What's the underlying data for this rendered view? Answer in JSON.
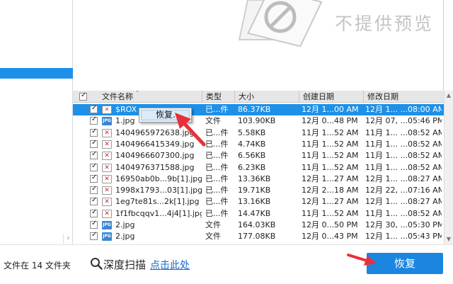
{
  "preview": {
    "no_preview_text": "不提供预览"
  },
  "table": {
    "columns": {
      "name": "文件名称",
      "type": "类型",
      "size": "大小",
      "created": "创建日期",
      "modified": "修改日期"
    },
    "rows": [
      {
        "icon": "doc",
        "name": "$ROX",
        "type": "已...件",
        "size": "86.37KB",
        "created": "12月 1...00 AM",
        "modified": "12月 1... ...08:00 AM",
        "selected": true
      },
      {
        "icon": "jpg",
        "name": "1.jpg",
        "type": "文件",
        "size": "103.90KB",
        "created": "12月 0...48 PM",
        "modified": "12月 07, ...05:46 PM"
      },
      {
        "icon": "broken",
        "name": "1404965972638.jpg",
        "type": "已...件",
        "size": "5.58KB",
        "created": "11月 1...52 AM",
        "modified": "11月 1... ...08:52 AM"
      },
      {
        "icon": "broken",
        "name": "1404966415349.jpg",
        "type": "已...件",
        "size": "4.74KB",
        "created": "11月 1...52 AM",
        "modified": "11月 1... ...08:52 AM"
      },
      {
        "icon": "broken",
        "name": "1404966607300.jpg",
        "type": "已...件",
        "size": "6.56KB",
        "created": "11月 1...52 AM",
        "modified": "11月 1... ...08:52 AM"
      },
      {
        "icon": "broken",
        "name": "1404976371588.jpg",
        "type": "已...件",
        "size": "6.23KB",
        "created": "11月 1...52 AM",
        "modified": "11月 1... ...08:52 AM"
      },
      {
        "icon": "broken",
        "name": "16950ab0b...9b[1].jpg",
        "type": "已...件",
        "size": "13.36KB",
        "created": "12月 1...27 AM",
        "modified": "12月 1... ...08:27 AM"
      },
      {
        "icon": "broken",
        "name": "1998x1793...03[1].jpg",
        "type": "已...件",
        "size": "19.71KB",
        "created": "12月 2...18 AM",
        "modified": "12月 22, ...07:16 AM"
      },
      {
        "icon": "broken",
        "name": "1eg7te81s...2k[1].jpg",
        "type": "已...件",
        "size": "13.16KB",
        "created": "12月 1...27 AM",
        "modified": "12月 1... ...08:27 AM"
      },
      {
        "icon": "broken",
        "name": "1f1fbcqqv1...4j4[1].jpg",
        "type": "已...件",
        "size": "14.47KB",
        "created": "11月 1...52 AM",
        "modified": "11月 1... ...08:52 AM"
      },
      {
        "icon": "jpg",
        "name": "2.jpg",
        "type": "文件",
        "size": "164.03KB",
        "created": "12月 0...50 PM",
        "modified": "12月 30, ...05:30 PM"
      },
      {
        "icon": "jpg",
        "name": "2.jpg",
        "type": "文件",
        "size": "177.08KB",
        "created": "12月 0...43 PM",
        "modified": "12月 1... ...05:43 PM"
      }
    ]
  },
  "context_menu": {
    "recover_label": "恢复..."
  },
  "footer": {
    "status_text": "文件在 14 文件夹",
    "deep_scan_label": "深度扫描",
    "click_here_link": "点击此处",
    "recover_button": "恢复"
  },
  "colors": {
    "selection": "#1e90e8",
    "button": "#1a86e0",
    "arrow": "#e8303a",
    "link": "#1667c9"
  }
}
